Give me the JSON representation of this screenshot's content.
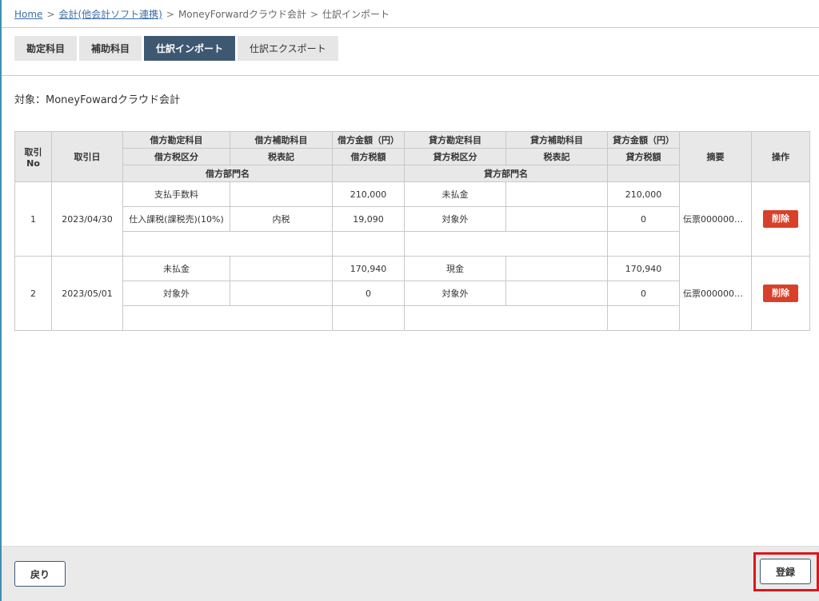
{
  "breadcrumb": {
    "home": "Home",
    "sep1": ">",
    "accounting": "会計(他会計ソフト連携)",
    "sep2": ">",
    "software": "MoneyForwardクラウド会計",
    "sep3": ">",
    "current": "仕訳インポート"
  },
  "tabs": [
    "勘定科目",
    "補助科目",
    "仕訳インポート",
    "仕訳エクスポート"
  ],
  "target_label": "対象：MoneyFowardクラウド会計",
  "table": {
    "headers": {
      "no": "取引\nNo",
      "date": "取引日",
      "debit_account": "借方勘定科目",
      "debit_sub": "借方補助科目",
      "debit_amount": "借方金額（円）",
      "credit_account": "貸方勘定科目",
      "credit_sub": "貸方補助科目",
      "credit_amount": "貸方金額（円）",
      "memo": "摘要",
      "action": "操作",
      "debit_tax_class": "借方税区分",
      "debit_tax_mark": "税表記",
      "debit_tax_amount": "借方税額",
      "credit_tax_class": "貸方税区分",
      "credit_tax_mark": "税表記",
      "credit_tax_amount": "貸方税額",
      "debit_dept": "借方部門名",
      "credit_dept": "貸方部門名"
    },
    "rows": [
      {
        "no": "1",
        "date": "2023/04/30",
        "debit_account": "支払手数料",
        "debit_sub": "",
        "debit_amount": "210,000",
        "credit_account": "未払金",
        "credit_sub": "",
        "credit_amount": "210,000",
        "debit_tax_class": "仕入課税(課税売)(10%)",
        "debit_tax_mark": "内税",
        "debit_tax_amount": "19,090",
        "credit_tax_class": "対象外",
        "credit_tax_mark": "",
        "credit_tax_amount": "0",
        "debit_dept": "",
        "credit_dept": "",
        "memo": "伝票0000000...",
        "delete_label": "削除"
      },
      {
        "no": "2",
        "date": "2023/05/01",
        "debit_account": "未払金",
        "debit_sub": "",
        "debit_amount": "170,940",
        "credit_account": "現金",
        "credit_sub": "",
        "credit_amount": "170,940",
        "debit_tax_class": "対象外",
        "debit_tax_mark": "",
        "debit_tax_amount": "0",
        "credit_tax_class": "対象外",
        "credit_tax_mark": "",
        "credit_tax_amount": "0",
        "debit_dept": "",
        "credit_dept": "",
        "memo": "伝票0000000...",
        "delete_label": "削除"
      }
    ]
  },
  "footer": {
    "back_label": "戻り",
    "register_label": "登録"
  },
  "colors": {
    "active_tab": "#3e5872",
    "delete_button": "#d8402a",
    "highlight": "#e0141c",
    "link": "#3b6ea8"
  }
}
